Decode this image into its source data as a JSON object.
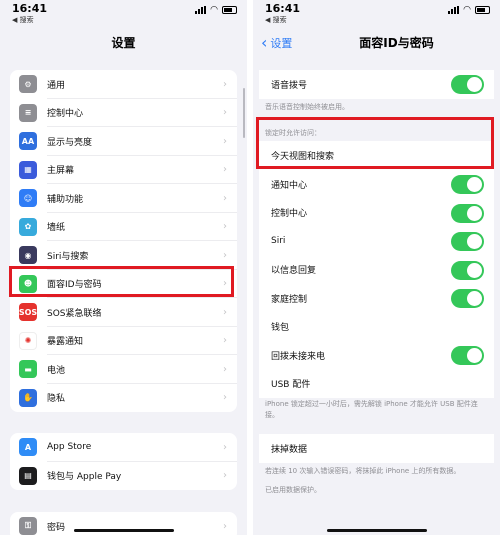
{
  "left": {
    "status": {
      "time": "16:41",
      "back_app": "搜索"
    },
    "title": "设置",
    "group1": [
      {
        "label": "通用",
        "icon": "gear-icon",
        "color": "#8e8e93",
        "glyph": "⚙"
      },
      {
        "label": "控制中心",
        "icon": "toggles-icon",
        "color": "#8e8e93",
        "glyph": "≡"
      },
      {
        "label": "显示与亮度",
        "icon": "display-aa-icon",
        "color": "#2f6fde",
        "glyph": "AA"
      },
      {
        "label": "主屏幕",
        "icon": "home-screen-icon",
        "color": "#3b5bdb",
        "glyph": "▦"
      },
      {
        "label": "辅助功能",
        "icon": "accessibility-icon",
        "color": "#2f7cf6",
        "glyph": "☺"
      },
      {
        "label": "墙纸",
        "icon": "wallpaper-icon",
        "color": "#37aadc",
        "glyph": "✿"
      },
      {
        "label": "Siri与搜索",
        "icon": "siri-icon",
        "color": "#3a3a5e",
        "glyph": "◉"
      },
      {
        "label": "面容ID与密码",
        "icon": "face-id-icon",
        "color": "#34c759",
        "glyph": "☻"
      },
      {
        "label": "SOS紧急联络",
        "icon": "sos-icon",
        "color": "#e5322d",
        "glyph": "SOS"
      },
      {
        "label": "暴露通知",
        "icon": "exposure-icon",
        "color": "#ffffff",
        "glyph": "✺"
      },
      {
        "label": "电池",
        "icon": "battery-icon",
        "color": "#34c759",
        "glyph": "▬"
      },
      {
        "label": "隐私",
        "icon": "hand-icon",
        "color": "#2f6fde",
        "glyph": "✋"
      }
    ],
    "group2": [
      {
        "label": "App Store",
        "icon": "app-store-icon",
        "color": "#2f8cf6",
        "glyph": "A"
      },
      {
        "label": "钱包与 Apple Pay",
        "icon": "wallet-icon",
        "color": "#1c1c1e",
        "glyph": "▤"
      }
    ],
    "group3": [
      {
        "label": "密码",
        "icon": "key-icon",
        "color": "#8e8e93",
        "glyph": "⚿"
      }
    ]
  },
  "right": {
    "status": {
      "time": "16:41",
      "back_app": "搜索"
    },
    "back_label": "设置",
    "title": "面容ID与密码",
    "voice_dial": "语音拨号",
    "voice_note": "音乐语音控制始终被启用。",
    "locked_header": "锁定时允许访问：",
    "today_view": "今天视图和搜索",
    "items": [
      "通知中心",
      "控制中心",
      "Siri",
      "以信息回复",
      "家庭控制",
      "钱包",
      "回拨未接来电",
      "USB 配件"
    ],
    "usb_note": "iPhone 锁定超过一小时后，需先解锁 iPhone 才能允许 USB 配件连接。",
    "erase": "抹掉数据",
    "erase_note": "若连续 10 次输入错误密码，将抹掉此 iPhone 上的所有数据。",
    "protect_note": "已启用数据保护。"
  }
}
